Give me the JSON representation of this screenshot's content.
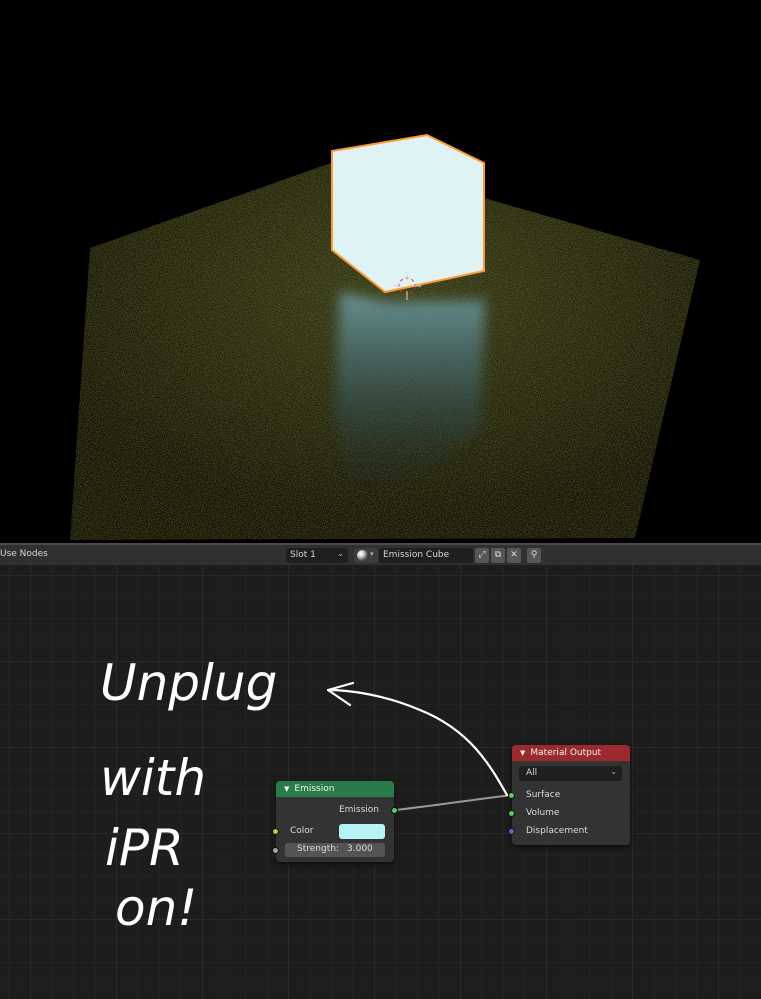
{
  "viewport": {
    "cube_color": "#dff2f4",
    "outline_color": "#ff9a2e"
  },
  "header": {
    "use_nodes_label": "Use Nodes",
    "slot_value": "Slot 1",
    "material_name": "Emission Cube",
    "icons": [
      "fake-user-icon",
      "duplicate-icon",
      "close-icon",
      "pin-icon"
    ]
  },
  "nodes": {
    "emission": {
      "title": "Emission",
      "output_label": "Emission",
      "color_label": "Color",
      "color_value": "#b6f3f7",
      "strength_label": "Strength:",
      "strength_value": "3.000",
      "header_color": "#2a7b4a"
    },
    "material_output": {
      "title": "Material Output",
      "target": "All",
      "inputs": [
        "Surface",
        "Volume",
        "Displacement"
      ],
      "header_color": "#9a2a2c"
    }
  },
  "annotation": {
    "lines": [
      "Unplug",
      "with",
      "iPR",
      "on!"
    ]
  }
}
